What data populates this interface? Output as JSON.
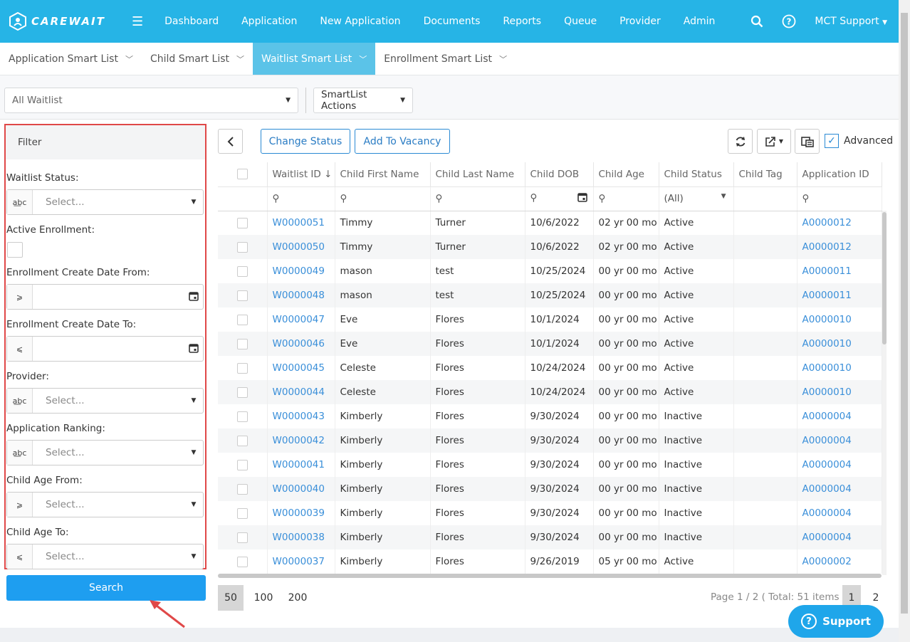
{
  "header": {
    "brand": "CAREWAIT",
    "nav": [
      "Dashboard",
      "Application",
      "New Application",
      "Documents",
      "Reports",
      "Queue",
      "Provider",
      "Admin"
    ],
    "user_menu": "MCT Support"
  },
  "smart_tabs": [
    {
      "label": "Application Smart List",
      "active": false
    },
    {
      "label": "Child Smart List",
      "active": false
    },
    {
      "label": "Waitlist Smart List",
      "active": true
    },
    {
      "label": "Enrollment Smart List",
      "active": false
    }
  ],
  "list_selector": "All Waitlist",
  "smartlist_actions": "SmartList Actions",
  "filter": {
    "title": "Filter",
    "waitlist_status_label": "Waitlist Status:",
    "active_enrollment_label": "Active Enrollment:",
    "create_from_label": "Enrollment Create Date From:",
    "create_to_label": "Enrollment Create Date To:",
    "provider_label": "Provider:",
    "ranking_label": "Application Ranking:",
    "age_from_label": "Child Age From:",
    "age_to_label": "Child Age To:",
    "select_placeholder": "Select...",
    "search_label": "Search"
  },
  "toolbar": {
    "change_status": "Change Status",
    "add_to_vacancy": "Add To Vacancy",
    "advanced": "Advanced"
  },
  "table": {
    "columns": [
      "Waitlist ID",
      "Child First Name",
      "Child Last Name",
      "Child DOB",
      "Child Age",
      "Child Status",
      "Child Tag",
      "Application ID"
    ],
    "status_filter": "(All)",
    "rows": [
      [
        "W0000051",
        "Timmy",
        "Turner",
        "10/6/2022",
        "02 yr 00 mo",
        "Active",
        "",
        "A0000012"
      ],
      [
        "W0000050",
        "Timmy",
        "Turner",
        "10/6/2022",
        "02 yr 00 mo",
        "Active",
        "",
        "A0000012"
      ],
      [
        "W0000049",
        "mason",
        "test",
        "10/25/2024",
        "00 yr 00 mo",
        "Active",
        "",
        "A0000011"
      ],
      [
        "W0000048",
        "mason",
        "test",
        "10/25/2024",
        "00 yr 00 mo",
        "Active",
        "",
        "A0000011"
      ],
      [
        "W0000047",
        "Eve",
        "Flores",
        "10/1/2024",
        "00 yr 00 mo",
        "Active",
        "",
        "A0000010"
      ],
      [
        "W0000046",
        "Eve",
        "Flores",
        "10/1/2024",
        "00 yr 00 mo",
        "Active",
        "",
        "A0000010"
      ],
      [
        "W0000045",
        "Celeste",
        "Flores",
        "10/24/2024",
        "00 yr 00 mo",
        "Active",
        "",
        "A0000010"
      ],
      [
        "W0000044",
        "Celeste",
        "Flores",
        "10/24/2024",
        "00 yr 00 mo",
        "Active",
        "",
        "A0000010"
      ],
      [
        "W0000043",
        "Kimberly",
        "Flores",
        "9/30/2024",
        "00 yr 00 mo",
        "Inactive",
        "",
        "A0000004"
      ],
      [
        "W0000042",
        "Kimberly",
        "Flores",
        "9/30/2024",
        "00 yr 00 mo",
        "Inactive",
        "",
        "A0000004"
      ],
      [
        "W0000041",
        "Kimberly",
        "Flores",
        "9/30/2024",
        "00 yr 00 mo",
        "Inactive",
        "",
        "A0000004"
      ],
      [
        "W0000040",
        "Kimberly",
        "Flores",
        "9/30/2024",
        "00 yr 00 mo",
        "Inactive",
        "",
        "A0000004"
      ],
      [
        "W0000039",
        "Kimberly",
        "Flores",
        "9/30/2024",
        "00 yr 00 mo",
        "Inactive",
        "",
        "A0000004"
      ],
      [
        "W0000038",
        "Kimberly",
        "Flores",
        "9/30/2024",
        "00 yr 00 mo",
        "Inactive",
        "",
        "A0000004"
      ],
      [
        "W0000037",
        "Kimberly",
        "Flores",
        "9/26/2019",
        "05 yr 00 mo",
        "Active",
        "",
        "A0000002"
      ]
    ]
  },
  "pager": {
    "sizes": [
      "50",
      "100",
      "200"
    ],
    "info": "Page 1 / 2 ( Total: 51 items )",
    "pages": [
      "1",
      "2"
    ]
  },
  "support": "Support",
  "colors": {
    "header": "#26b4e6",
    "active_tab": "#5bc3e8",
    "link": "#3a8fd9",
    "highlight": "#e04848"
  }
}
